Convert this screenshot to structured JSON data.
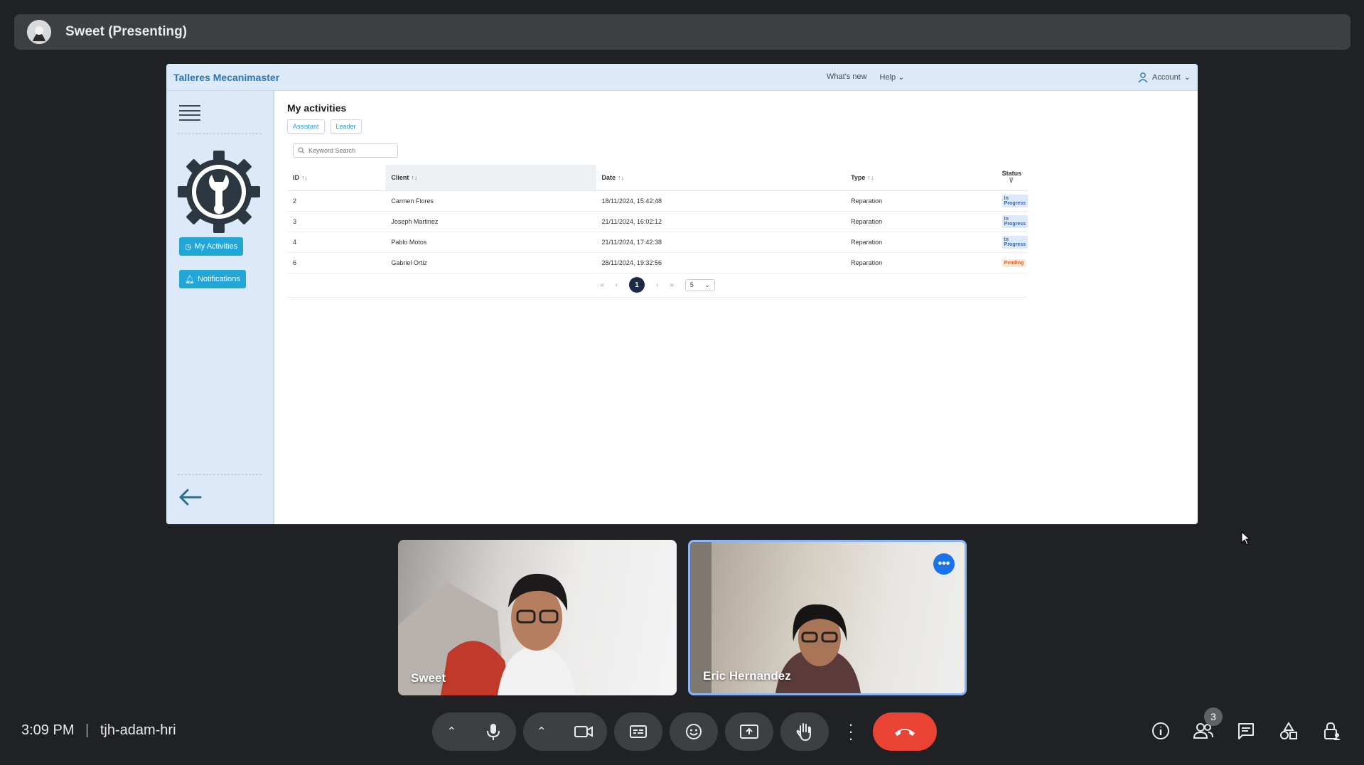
{
  "presenter": {
    "title": "Sweet (Presenting)"
  },
  "app": {
    "brand": "Talleres Mecanimaster",
    "header_links": [
      "What's new",
      "Help"
    ],
    "account_label": "Account",
    "sidebar": {
      "buttons": [
        {
          "label": "My Activities",
          "icon": "clock-icon"
        },
        {
          "label": "Notifications",
          "icon": "bell-icon"
        }
      ]
    },
    "page_title": "My activities",
    "tabs": [
      "Assistant",
      "Leader"
    ],
    "search": {
      "placeholder": "Keyword Search"
    },
    "table": {
      "columns": [
        "ID",
        "Client",
        "Date",
        "Type",
        "Status"
      ],
      "rows": [
        {
          "id": "2",
          "client": "Carmen Flores",
          "date": "18/11/2024, 15:42:48",
          "type": "Reparation",
          "status": "In Progress"
        },
        {
          "id": "3",
          "client": "Joseph Martinez",
          "date": "21/11/2024, 16:02:12",
          "type": "Reparation",
          "status": "In Progress"
        },
        {
          "id": "4",
          "client": "Pablo Motos",
          "date": "21/11/2024, 17:42:38",
          "type": "Reparation",
          "status": "In Progress"
        },
        {
          "id": "6",
          "client": "Gabriel Ortiz",
          "date": "28/11/2024, 19:32:56",
          "type": "Reparation",
          "status": "Pending"
        }
      ]
    },
    "pagination": {
      "current_page": "1",
      "page_size": "5"
    },
    "status_colors": {
      "In Progress": {
        "bg": "#dce8fb",
        "fg": "#2f5fc4"
      },
      "Pending": {
        "bg": "#fde6d6",
        "fg": "#d2631c"
      }
    }
  },
  "participants": [
    {
      "name": "Sweet"
    },
    {
      "name": "Eric Hernandez"
    }
  ],
  "meeting": {
    "time": "3:09 PM",
    "code": "tjh-adam-hri",
    "participant_count": "3"
  },
  "colors": {
    "end_call": "#ea4335",
    "accent": "#1a73e8"
  }
}
